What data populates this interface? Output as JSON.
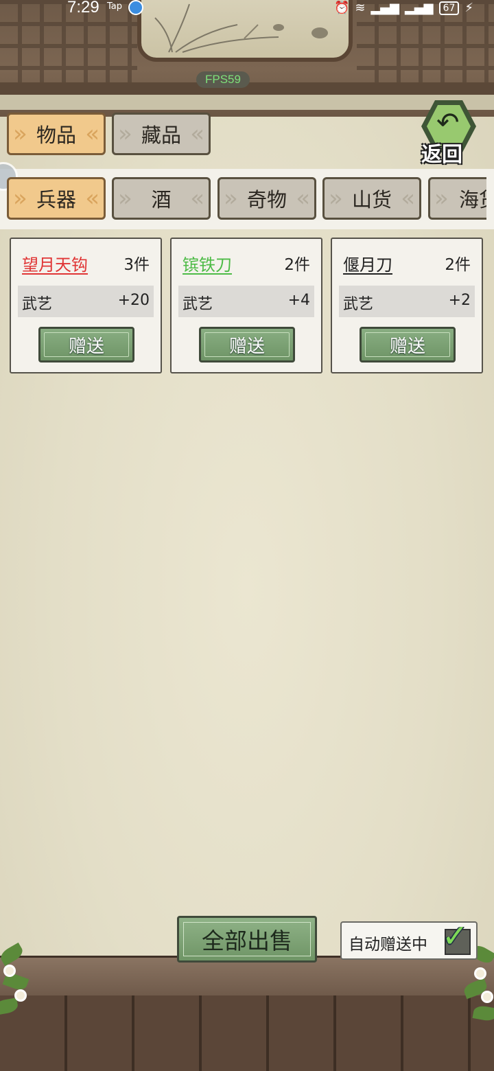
{
  "status_bar": {
    "time": "7:29",
    "tap_label": "Tap",
    "battery": "67",
    "icons": [
      "alarm-icon",
      "wifi-icon",
      "signal-4g-icon",
      "signal-4g-icon",
      "battery-icon",
      "charging-icon"
    ]
  },
  "fps": "FPS59",
  "main_tabs": [
    {
      "label": "物品",
      "active": true
    },
    {
      "label": "藏品",
      "active": false
    }
  ],
  "back": {
    "label": "返回"
  },
  "sub_tabs": [
    {
      "label": "兵器",
      "active": true
    },
    {
      "label": "酒",
      "active": false
    },
    {
      "label": "奇物",
      "active": false
    },
    {
      "label": "山货",
      "active": false
    },
    {
      "label": "海货",
      "active": false
    }
  ],
  "items": [
    {
      "name": "望月天钩",
      "name_color": "#e03535",
      "count": "3件",
      "stat_name": "武艺",
      "stat_value": "+20",
      "button": "赠送"
    },
    {
      "name": "镔铁刀",
      "name_color": "#4dbb46",
      "count": "2件",
      "stat_name": "武艺",
      "stat_value": "+4",
      "button": "赠送"
    },
    {
      "name": "偃月刀",
      "name_color": "#222222",
      "count": "2件",
      "stat_name": "武艺",
      "stat_value": "+2",
      "button": "赠送"
    }
  ],
  "bottom": {
    "sell_all": "全部出售",
    "auto_gift": "自动赠送中",
    "auto_gift_checked": true
  }
}
